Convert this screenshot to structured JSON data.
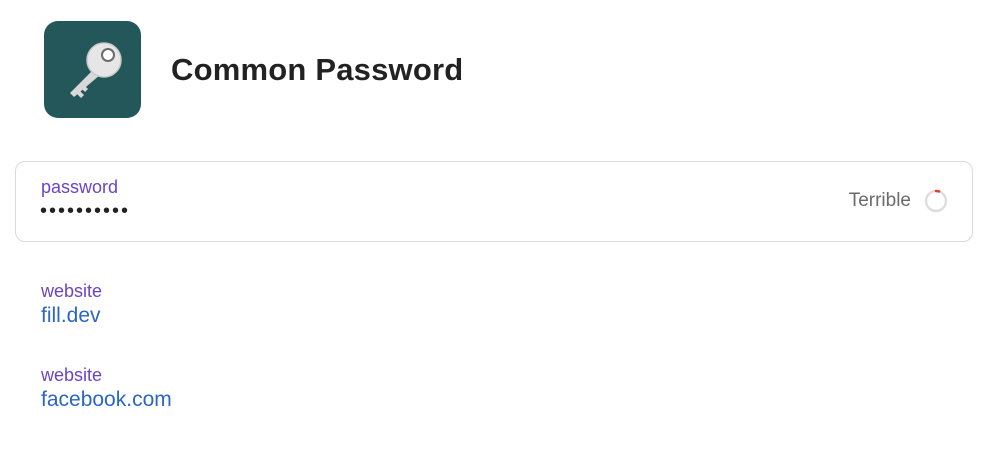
{
  "item": {
    "title": "Common Password",
    "icon": "key-icon",
    "icon_bg_color": "#23575a"
  },
  "password_field": {
    "label": "password",
    "value": "••••••••••",
    "strength_label": "Terrible",
    "strength_fraction": 0.05,
    "strength_color": "#e0402c"
  },
  "websites": [
    {
      "label": "website",
      "url": "fill.dev"
    },
    {
      "label": "website",
      "url": "facebook.com"
    }
  ],
  "colors": {
    "label_purple": "#6a44c7",
    "link_blue": "#2c66c4"
  }
}
